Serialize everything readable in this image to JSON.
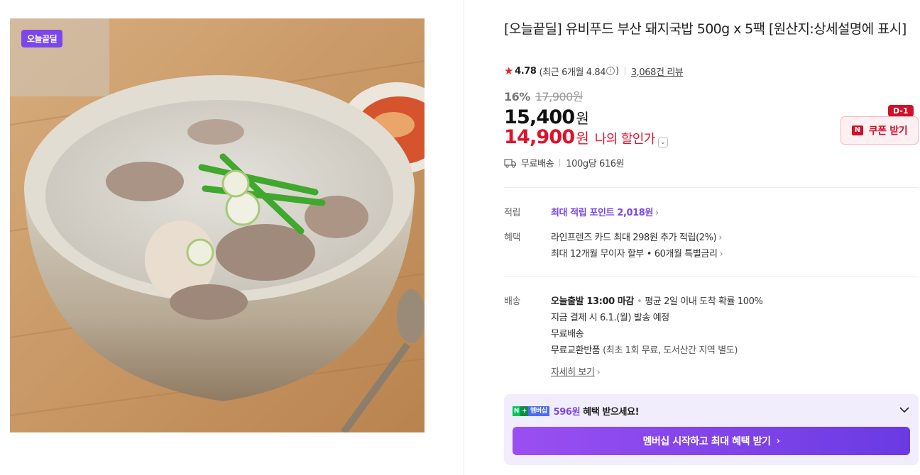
{
  "product": {
    "badge": "오늘끝딜",
    "title": "[오늘끝딜] 유비푸드 부산 돼지국밥 500g x 5팩 [원산지:상세설명에 표시]"
  },
  "rating": {
    "score": "4.78",
    "recent_prefix": "(최근 6개월 4.84",
    "info_icon": "ⓘ",
    "recent_suffix": ")",
    "review_count": "3,068건 리뷰"
  },
  "price": {
    "discount_rate": "16%",
    "original": "17,900원",
    "sale": "15,400",
    "sale_unit": "원",
    "my_price": "14,900",
    "my_price_unit": "원",
    "my_price_label": "나의 할인가"
  },
  "coupon": {
    "d_day": "D-1",
    "icon": "N",
    "label": "쿠폰 받기"
  },
  "shipping_summary": {
    "free": "무료배송",
    "unit_price": "100g당 616원"
  },
  "points": {
    "label": "적립",
    "text": "최대 적립 포인트 2,018원"
  },
  "benefits": {
    "label": "혜택",
    "items": [
      "라인프렌즈 카드 최대 298원 추가 적립(2%)",
      "최대 12개월 무이자 할부 • 60개월 특별금리"
    ]
  },
  "delivery": {
    "label": "배송",
    "today": "오늘출발 13:00 마감",
    "avg": "평균 2일 이내 도착 확률 100%",
    "schedule": "지금 결제 시 6.1.(월) 발송 예정",
    "free": "무료배송",
    "exchange": "무료교환반품",
    "exchange_note": "(최초 1회 무료, 도서산간 지역 별도)",
    "details_link": "자세히 보기"
  },
  "membership": {
    "logo_n": "N",
    "logo_plus": "+",
    "logo_text": "멤버십",
    "amount": "596원",
    "text": "혜택 받으세요!",
    "button": "멤버십 시작하고 최대 혜택 받기"
  },
  "colors": {
    "accent_red": "#e0112b",
    "accent_purple": "#7b47ea"
  }
}
